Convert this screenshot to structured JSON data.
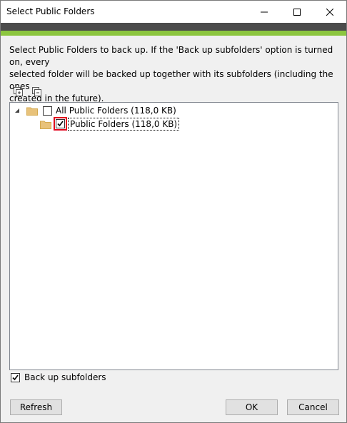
{
  "window": {
    "title": "Select Public Folders",
    "controls": {
      "minimize": "minimize-icon",
      "maximize": "maximize-icon",
      "close": "close-icon"
    }
  },
  "colors": {
    "header_dark": "#4b4b4b",
    "header_accent": "#8cc63f",
    "highlight": "#e3001b",
    "folder": "#e8c27a"
  },
  "description": {
    "line1": "Select Public Folders to back up. If the 'Back up subfolders' option is turned on, every",
    "line2": "selected folder will be backed up together with its subfolders (including the ones",
    "line3": "created in the future)."
  },
  "toolbar": {
    "expand_all_icon": "expand-all-icon",
    "collapse_all_icon": "collapse-all-icon"
  },
  "tree": {
    "items": [
      {
        "label": "All Public Folders (118,0 KB)",
        "checked": false,
        "expanded": true,
        "level": 0
      },
      {
        "label": "Public Folders (118,0 KB)",
        "checked": true,
        "level": 1
      }
    ]
  },
  "options": {
    "backup_subfolders_label": "Back up subfolders",
    "backup_subfolders_checked": true
  },
  "buttons": {
    "refresh": "Refresh",
    "ok": "OK",
    "cancel": "Cancel"
  }
}
